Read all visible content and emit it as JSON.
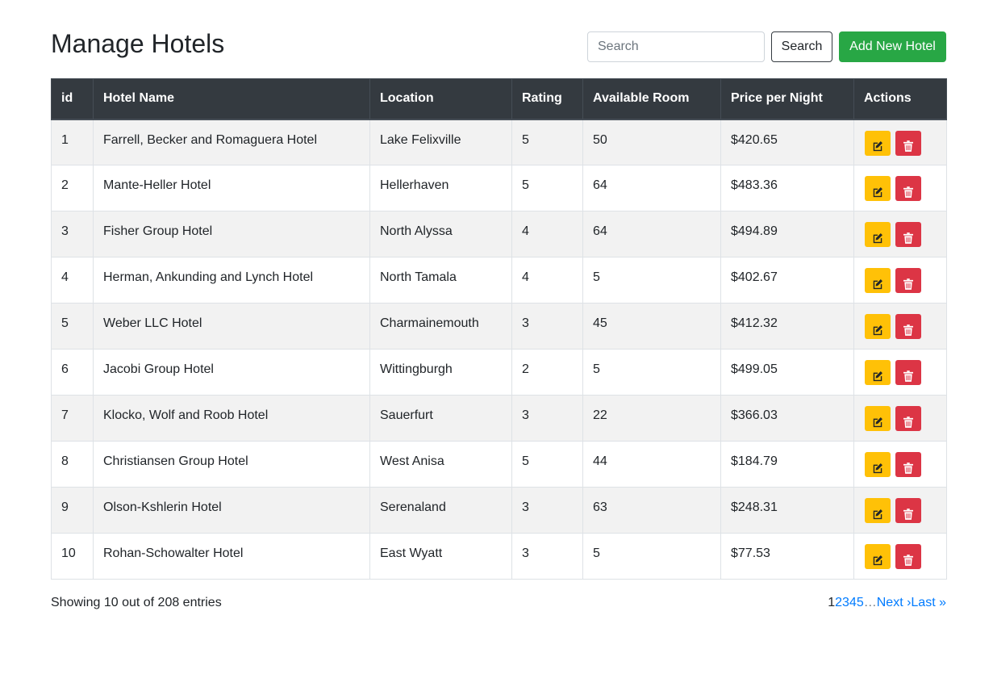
{
  "page": {
    "title": "Manage Hotels"
  },
  "toolbar": {
    "search_placeholder": "Search",
    "search_value": "",
    "search_button": "Search",
    "add_button": "Add New Hotel"
  },
  "table": {
    "columns": [
      "id",
      "Hotel Name",
      "Location",
      "Rating",
      "Available Room",
      "Price per Night",
      "Actions"
    ],
    "rows": [
      {
        "id": "1",
        "name": "Farrell, Becker and Romaguera Hotel",
        "location": "Lake Felixville",
        "rating": "5",
        "rooms": "50",
        "price": "$420.65"
      },
      {
        "id": "2",
        "name": "Mante-Heller Hotel",
        "location": "Hellerhaven",
        "rating": "5",
        "rooms": "64",
        "price": "$483.36"
      },
      {
        "id": "3",
        "name": "Fisher Group Hotel",
        "location": "North Alyssa",
        "rating": "4",
        "rooms": "64",
        "price": "$494.89"
      },
      {
        "id": "4",
        "name": "Herman, Ankunding and Lynch Hotel",
        "location": "North Tamala",
        "rating": "4",
        "rooms": "5",
        "price": "$402.67"
      },
      {
        "id": "5",
        "name": "Weber LLC Hotel",
        "location": "Charmainemouth",
        "rating": "3",
        "rooms": "45",
        "price": "$412.32"
      },
      {
        "id": "6",
        "name": "Jacobi Group Hotel",
        "location": "Wittingburgh",
        "rating": "2",
        "rooms": "5",
        "price": "$499.05"
      },
      {
        "id": "7",
        "name": "Klocko, Wolf and Roob Hotel",
        "location": "Sauerfurt",
        "rating": "3",
        "rooms": "22",
        "price": "$366.03"
      },
      {
        "id": "8",
        "name": "Christiansen Group Hotel",
        "location": "West Anisa",
        "rating": "5",
        "rooms": "44",
        "price": "$184.79"
      },
      {
        "id": "9",
        "name": "Olson-Kshlerin Hotel",
        "location": "Serenaland",
        "rating": "3",
        "rooms": "63",
        "price": "$248.31"
      },
      {
        "id": "10",
        "name": "Rohan-Schowalter Hotel",
        "location": "East Wyatt",
        "rating": "3",
        "rooms": "5",
        "price": "$77.53"
      }
    ],
    "row_actions": [
      {
        "icon": "edit-icon",
        "color": "#ffc107"
      },
      {
        "icon": "trash-icon",
        "color": "#dc3545"
      }
    ]
  },
  "footer": {
    "info": "Showing 10 out of 208 entries",
    "pagination": {
      "current": "1",
      "pages": [
        "2",
        "3",
        "4",
        "5"
      ],
      "ellipsis": "…",
      "next": "Next ›",
      "last": "Last »"
    }
  },
  "colors": {
    "header_bg": "#343a40",
    "add_button": "#28a745",
    "edit_button": "#ffc107",
    "delete_button": "#dc3545",
    "link": "#007bff",
    "striped_row": "#f2f2f2"
  }
}
